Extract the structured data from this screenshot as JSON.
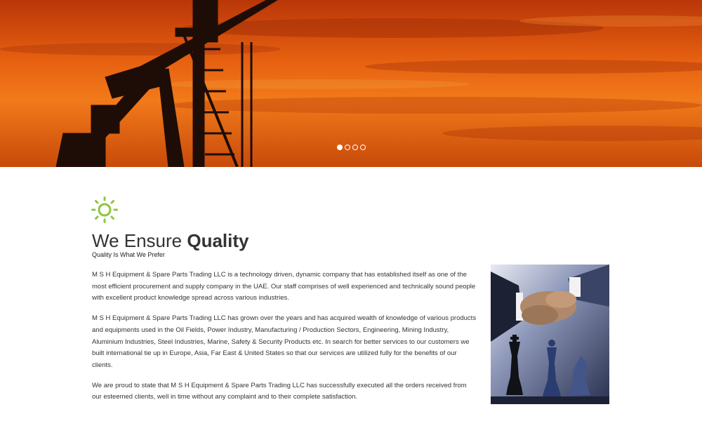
{
  "hero": {
    "slides": [
      {
        "active": true
      },
      {
        "active": false
      },
      {
        "active": false
      },
      {
        "active": false
      }
    ]
  },
  "section": {
    "icon": "sun-icon",
    "accent_color": "#8dc63f",
    "heading_light": "We Ensure ",
    "heading_bold": "Quality",
    "subheading": "Quality Is What We Prefer",
    "paragraphs": [
      "M S H Equipment & Spare Parts Trading LLC is a technology driven, dynamic company that has established itself as one of the most efficient procurement and supply company in the UAE. Our staff comprises of well experienced and technically sound people with excellent product knowledge spread across various industries.",
      "M S H Equipment & Spare Parts Trading LLC has grown over the years and has acquired wealth of knowledge of various products and equipments used in the Oil Fields, Power Industry, Manufacturing / Production Sectors, Engineering, Mining Industry, Aluminium Industries, Steel Industries, Marine, Safety & Security Products etc. In search for better services to our customers we built international tie up in Europe, Asia, Far East & United States so that our services are utilized fully for the benefits of our clients.",
      "We are proud to state that M S H Equipment & Spare Parts Trading LLC has successfully executed all the orders received from our esteemed clients, well in time without any complaint and to their complete satisfaction."
    ]
  }
}
